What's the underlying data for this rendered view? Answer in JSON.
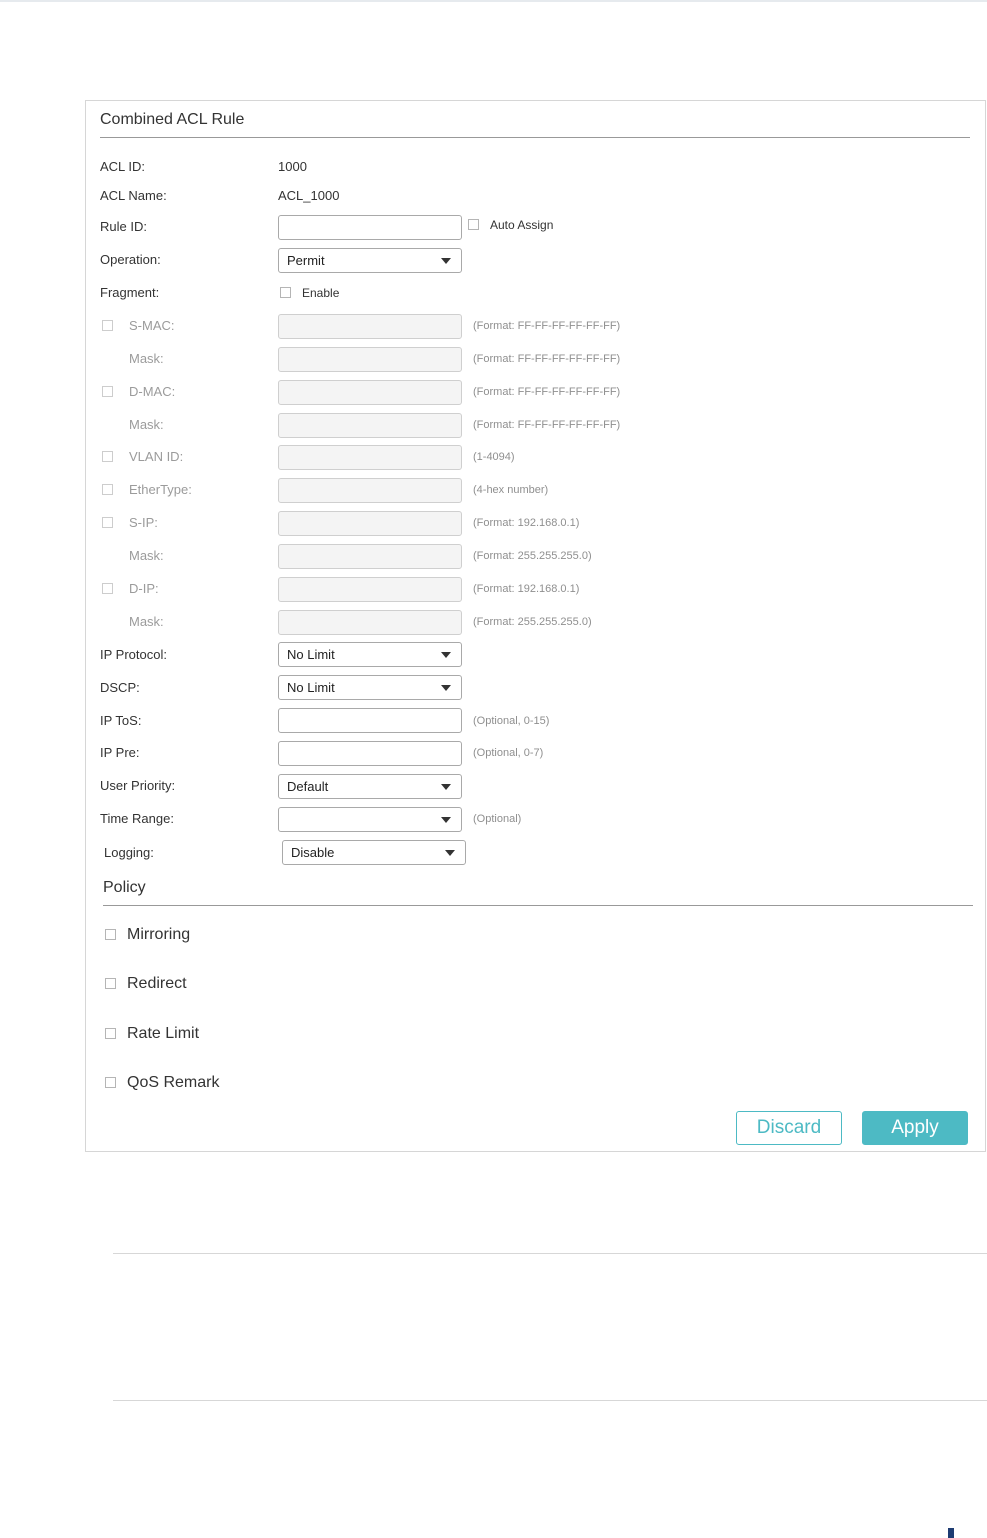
{
  "panel": {
    "title": "Combined ACL Rule"
  },
  "fields": {
    "acl_id": {
      "label": "ACL ID:",
      "value": "1000"
    },
    "acl_name": {
      "label": "ACL Name:",
      "value": "ACL_1000"
    },
    "rule_id": {
      "label": "Rule ID:",
      "value": "",
      "auto_assign_label": "Auto Assign"
    },
    "operation": {
      "label": "Operation:",
      "selected": "Permit"
    },
    "fragment": {
      "label": "Fragment:",
      "enable_label": "Enable"
    },
    "s_mac": {
      "label": "S-MAC:",
      "hint": "(Format: FF-FF-FF-FF-FF-FF)"
    },
    "s_mac_mask": {
      "label": "Mask:",
      "hint": "(Format: FF-FF-FF-FF-FF-FF)"
    },
    "d_mac": {
      "label": "D-MAC:",
      "hint": "(Format: FF-FF-FF-FF-FF-FF)"
    },
    "d_mac_mask": {
      "label": "Mask:",
      "hint": "(Format: FF-FF-FF-FF-FF-FF)"
    },
    "vlan_id": {
      "label": "VLAN ID:",
      "hint": "(1-4094)"
    },
    "ethertype": {
      "label": "EtherType:",
      "hint": "(4-hex number)"
    },
    "s_ip": {
      "label": "S-IP:",
      "hint": "(Format: 192.168.0.1)"
    },
    "s_ip_mask": {
      "label": "Mask:",
      "hint": "(Format: 255.255.255.0)"
    },
    "d_ip": {
      "label": "D-IP:",
      "hint": "(Format: 192.168.0.1)"
    },
    "d_ip_mask": {
      "label": "Mask:",
      "hint": "(Format: 255.255.255.0)"
    },
    "ip_protocol": {
      "label": "IP Protocol:",
      "selected": "No Limit"
    },
    "dscp": {
      "label": "DSCP:",
      "selected": "No Limit"
    },
    "ip_tos": {
      "label": "IP ToS:",
      "value": "",
      "hint": "(Optional, 0-15)"
    },
    "ip_pre": {
      "label": "IP Pre:",
      "value": "",
      "hint": "(Optional, 0-7)"
    },
    "user_priority": {
      "label": "User Priority:",
      "selected": "Default"
    },
    "time_range": {
      "label": "Time Range:",
      "selected": "",
      "hint": "(Optional)"
    },
    "logging": {
      "label": "Logging:",
      "selected": "Disable"
    }
  },
  "policy": {
    "title": "Policy",
    "items": [
      {
        "label": "Mirroring"
      },
      {
        "label": "Redirect"
      },
      {
        "label": "Rate Limit"
      },
      {
        "label": "QoS Remark"
      }
    ]
  },
  "buttons": {
    "discard": "Discard",
    "apply": "Apply"
  },
  "colors": {
    "accent": "#4dbac4",
    "disabled_text": "#9b9b9b"
  }
}
